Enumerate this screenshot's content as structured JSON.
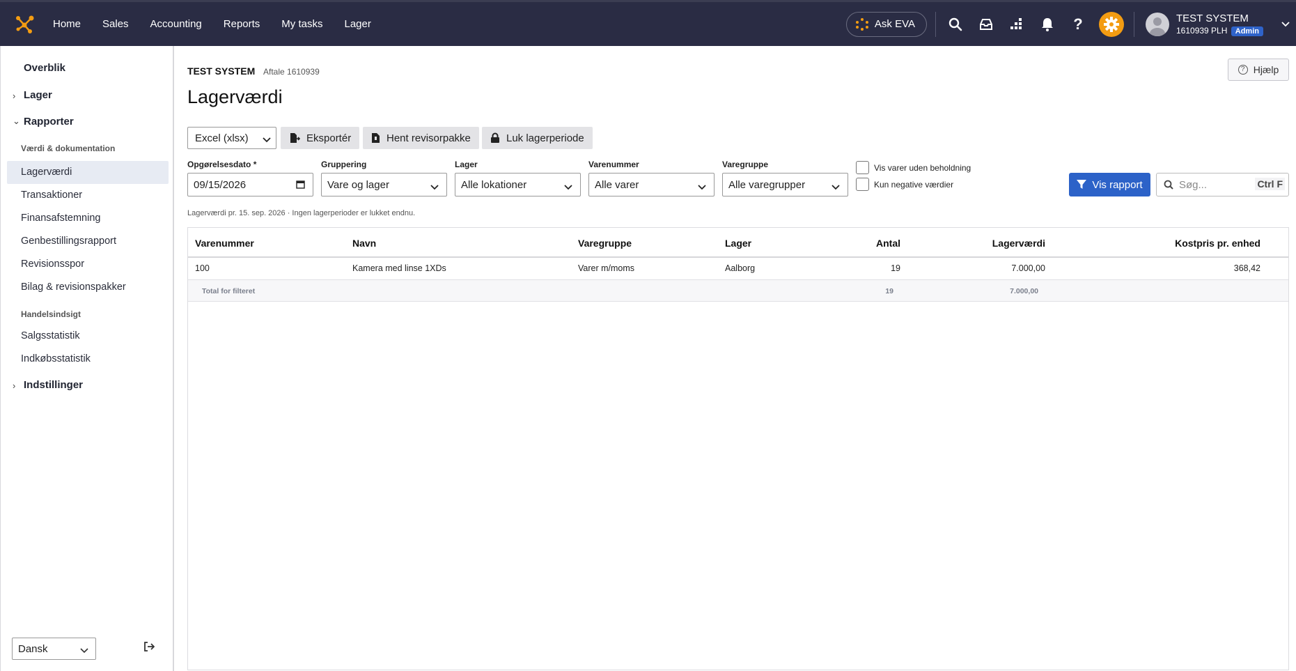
{
  "nav": {
    "items": [
      "Home",
      "Sales",
      "Accounting",
      "Reports",
      "My tasks",
      "Lager"
    ]
  },
  "topbar": {
    "ask_eva": "Ask EVA",
    "user_name": "TEST SYSTEM",
    "user_sub": "1610939 PLH",
    "user_role": "Admin",
    "accent_color": "#f39c12",
    "icons": [
      "search-icon",
      "inbox-icon",
      "apps-icon",
      "bell-icon",
      "help-icon",
      "gear-icon"
    ]
  },
  "sidebar": {
    "overblik": "Overblik",
    "lager": "Lager",
    "rapporter": "Rapporter",
    "section_1": "Værdi & dokumentation",
    "items_1": [
      "Lagerværdi",
      "Transaktioner",
      "Finansafstemning",
      "Genbestillingsrapport",
      "Revisionsspor",
      "Bilag & revisionspakker"
    ],
    "section_2": "Handelsindsigt",
    "items_2": [
      "Salgsstatistik",
      "Indkøbsstatistik"
    ],
    "indstillinger": "Indstillinger",
    "language": "Dansk",
    "active": "Lagerværdi"
  },
  "header": {
    "company": "TEST SYSTEM",
    "aftale": "Aftale 1610939",
    "title": "Lagerværdi",
    "help": "Hjælp"
  },
  "toolbar": {
    "format": "Excel (xlsx)",
    "export": "Eksportér",
    "revisor": "Hent revisorpakke",
    "luk": "Luk lagerperiode"
  },
  "filters": {
    "date_label": "Opgørelsesdato *",
    "date_value": "09/15/2026",
    "grouping_label": "Gruppering",
    "grouping_value": "Vare og lager",
    "lager_label": "Lager",
    "lager_value": "Alle lokationer",
    "varenummer_label": "Varenummer",
    "varenummer_value": "Alle varer",
    "varegruppe_label": "Varegruppe",
    "varegruppe_value": "Alle varegrupper",
    "cb1": "Vis varer uden beholdning",
    "cb2": "Kun negative værdier",
    "vis_rapport": "Vis rapport",
    "search_placeholder": "Søg...",
    "search_shortcut": "Ctrl F"
  },
  "info": "Lagerværdi pr. 15. sep. 2026 · Ingen lagerperioder er lukket endnu.",
  "table": {
    "headers": [
      "Varenummer",
      "Navn",
      "Varegruppe",
      "Lager",
      "Antal",
      "Lagerværdi",
      "Kostpris pr. enhed"
    ],
    "rows": [
      [
        "100",
        "Kamera med linse 1XDs",
        "Varer m/moms",
        "Aalborg",
        "19",
        "7.000,00",
        "368,42"
      ]
    ],
    "total": {
      "label": "Total for filteret",
      "antal": "19",
      "vaerdi": "7.000,00"
    }
  }
}
